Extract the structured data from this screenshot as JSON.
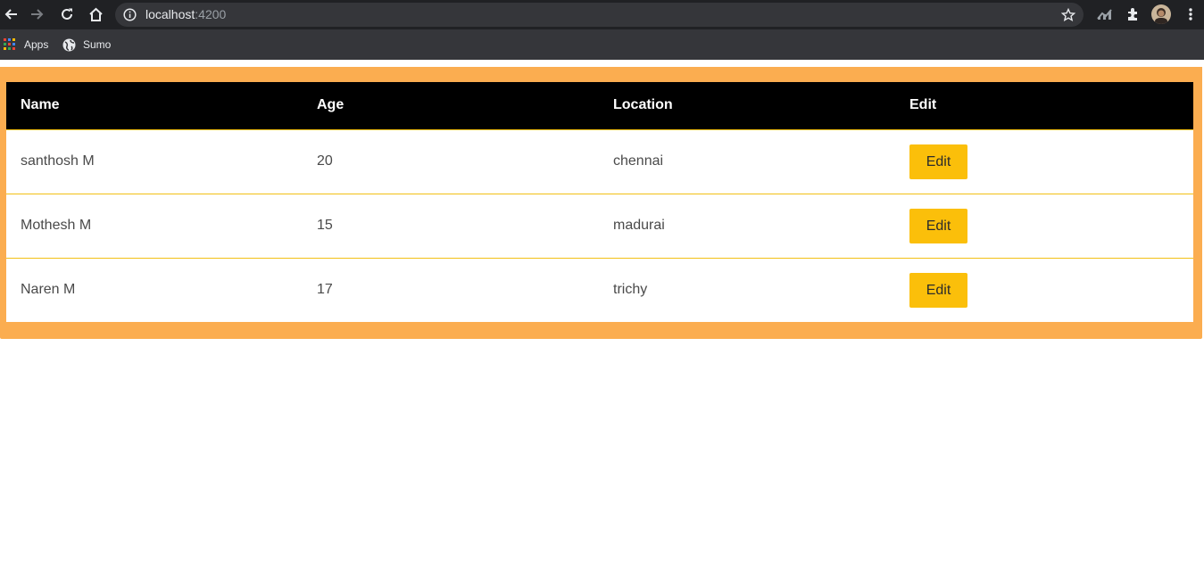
{
  "browser": {
    "url_host": "localhost",
    "url_port": ":4200",
    "icons": [
      "back-icon",
      "forward-icon",
      "reload-icon",
      "home-icon",
      "info-icon",
      "star-icon",
      "analytics-extension-icon",
      "extensions-icon",
      "profile-avatar",
      "menu-icon"
    ]
  },
  "bookmarks": [
    {
      "label": "Apps",
      "icon": "apps-grid-icon"
    },
    {
      "label": "Sumo",
      "icon": "globe-icon"
    }
  ],
  "table": {
    "headers": [
      "Name",
      "Age",
      "Location",
      "Edit"
    ],
    "rows": [
      {
        "name": "santhosh M",
        "age": "20",
        "location": "chennai",
        "action": "Edit"
      },
      {
        "name": "Mothesh M",
        "age": "15",
        "location": "madurai",
        "action": "Edit"
      },
      {
        "name": "Naren M",
        "age": "17",
        "location": "trichy",
        "action": "Edit"
      }
    ]
  },
  "colors": {
    "card_background": "#fbad50",
    "header_background": "#000000",
    "edit_button": "#fbbf0a",
    "row_divider": "#f2c014"
  }
}
